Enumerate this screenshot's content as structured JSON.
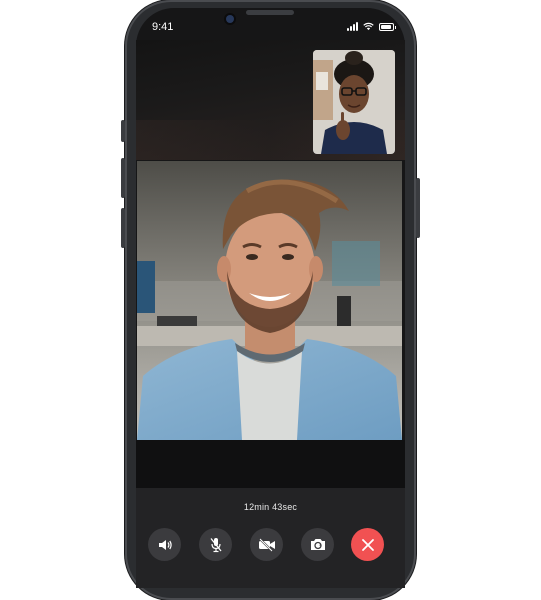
{
  "status_bar": {
    "time": "9:41"
  },
  "call": {
    "duration": "12min 43sec"
  },
  "controls": [
    {
      "name": "speaker-button",
      "icon": "speaker-icon"
    },
    {
      "name": "mute-button",
      "icon": "mic-off-icon"
    },
    {
      "name": "video-toggle-button",
      "icon": "video-off-icon"
    },
    {
      "name": "flip-camera-button",
      "icon": "flip-camera-icon"
    },
    {
      "name": "end-call-button",
      "icon": "close-icon",
      "color": "#f15152"
    }
  ],
  "colors": {
    "end_call": "#f15152",
    "control_bg": "#3b3b3e",
    "panel_bg": "#232325"
  }
}
